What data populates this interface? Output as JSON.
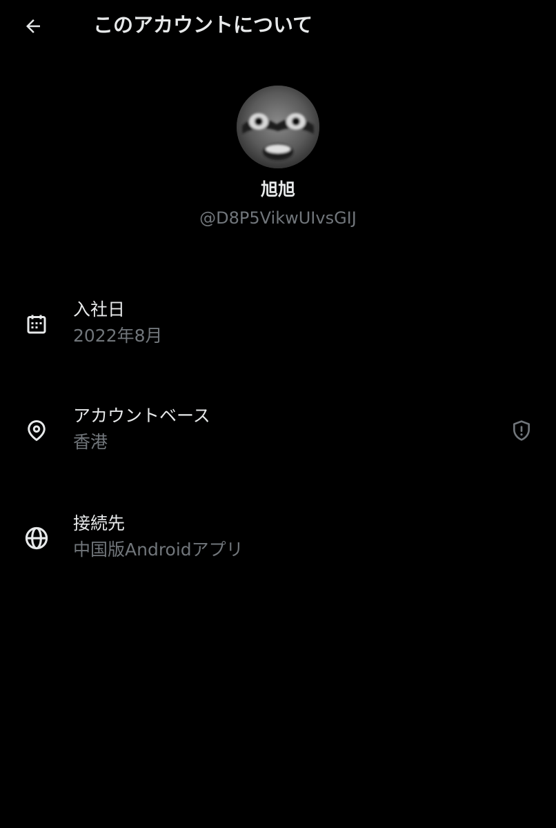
{
  "header": {
    "title": "このアカウントについて",
    "back_icon": "arrow-left-icon"
  },
  "profile": {
    "display_name": "旭旭",
    "handle": "@D8P5VikwUIvsGIJ"
  },
  "rows": [
    {
      "icon": "calendar-icon",
      "label": "入社日",
      "value": "2022年8月"
    },
    {
      "icon": "location-pin-icon",
      "label": "アカウントベース",
      "value": "香港",
      "trailing_icon": "shield-alert-icon"
    },
    {
      "icon": "globe-icon",
      "label": "接続先",
      "value": "中国版Androidアプリ"
    }
  ],
  "colors": {
    "background": "#000000",
    "primary_text": "#e7e9ea",
    "secondary_text": "#71767b"
  }
}
